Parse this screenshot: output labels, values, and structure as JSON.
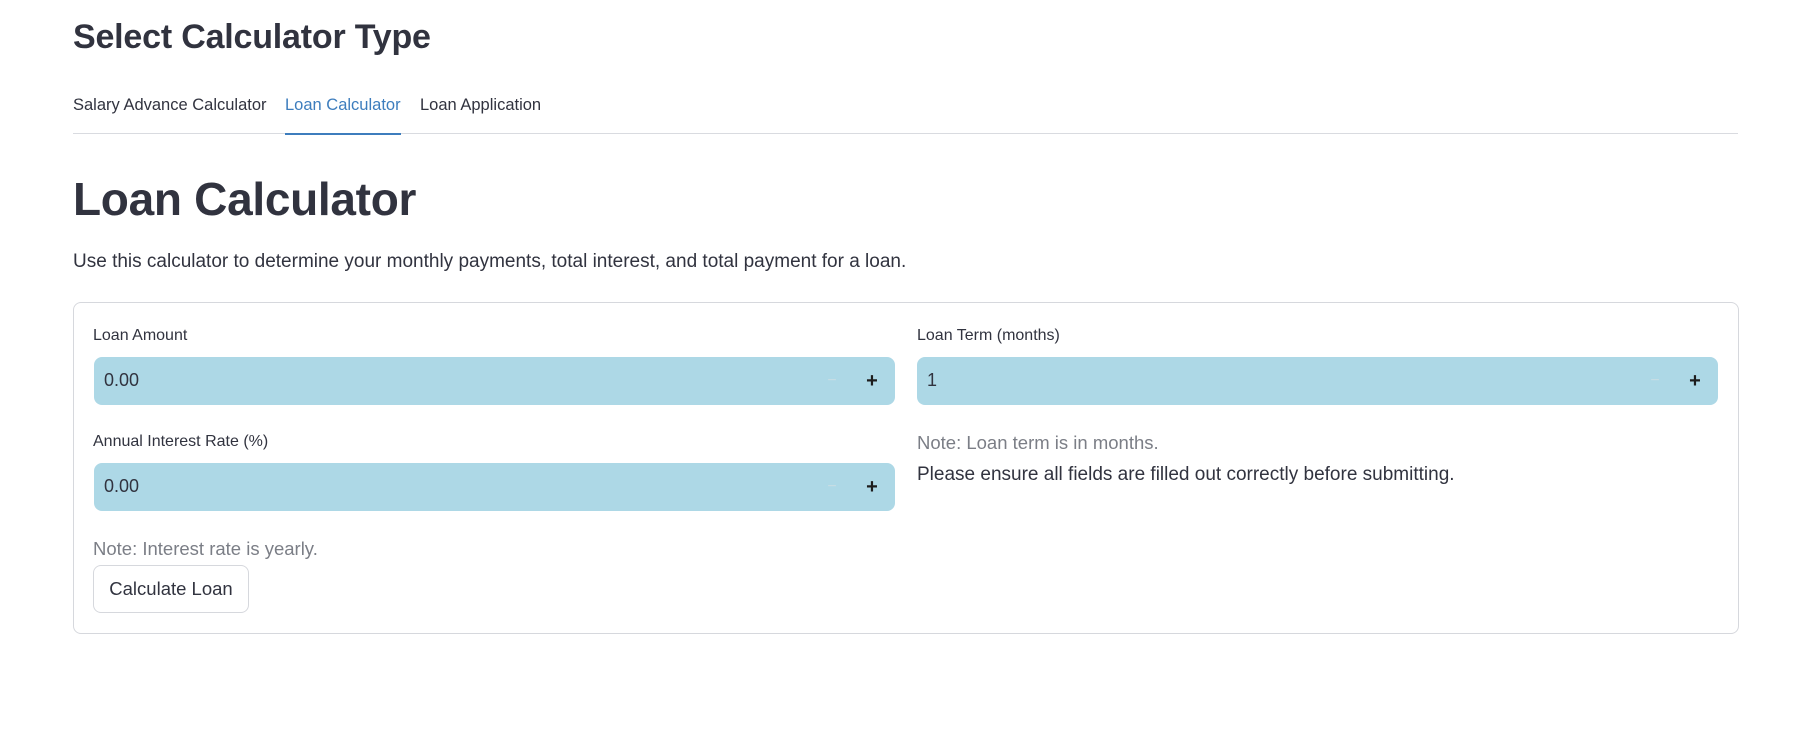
{
  "header": {
    "title": "Select Calculator Type"
  },
  "tabs": [
    {
      "label": "Salary Advance Calculator",
      "active": false
    },
    {
      "label": "Loan Calculator",
      "active": true
    },
    {
      "label": "Loan Application",
      "active": false
    }
  ],
  "main": {
    "title": "Loan Calculator",
    "description": "Use this calculator to determine your monthly payments, total interest, and total payment for a loan."
  },
  "form": {
    "loan_amount": {
      "label": "Loan Amount",
      "value": "0.00"
    },
    "loan_term": {
      "label": "Loan Term (months)",
      "value": "1"
    },
    "interest_rate": {
      "label": "Annual Interest Rate (%)",
      "value": "0.00"
    },
    "term_note": "Note: Loan term is in months.",
    "submit_info": "Please ensure all fields are filled out correctly before submitting.",
    "rate_note": "Note: Interest rate is yearly.",
    "calculate_label": "Calculate Loan",
    "stepper_minus": "−",
    "stepper_plus": "+"
  },
  "colors": {
    "accent": "#3d7dbd",
    "input_background": "#add8e6",
    "text": "#31333f",
    "muted_text": "#7b7e86"
  }
}
